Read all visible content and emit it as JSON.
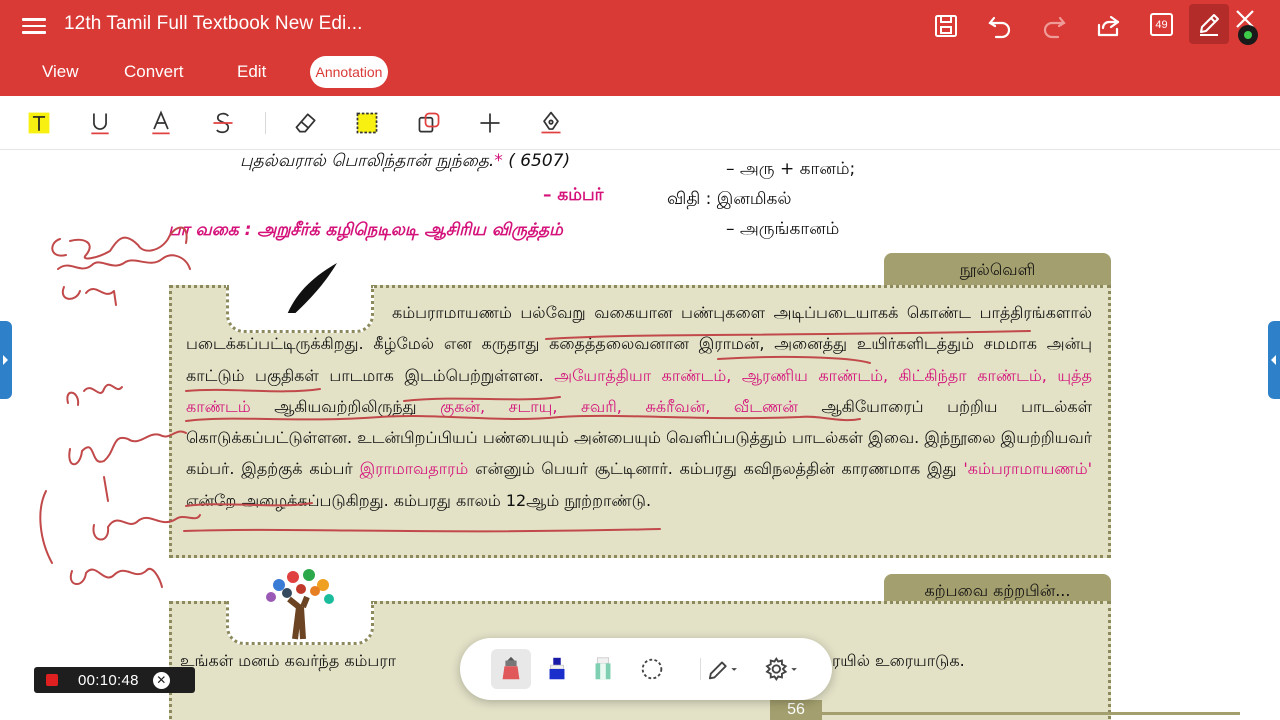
{
  "app": {
    "title": "12th Tamil Full Textbook New Edi...",
    "page_count_badge": "49",
    "colors": {
      "primary": "#d93a36",
      "accent_magenta": "#d4127a",
      "olive": "#a39f6e",
      "box_bg": "#e3e2c7"
    }
  },
  "toolbar_icons": [
    "save-icon",
    "undo-icon",
    "redo-icon",
    "share-icon",
    "page-count-icon",
    "pen-edit-icon",
    "close-icon"
  ],
  "tabs": [
    {
      "label": "View"
    },
    {
      "label": "Convert"
    },
    {
      "label": "Edit"
    },
    {
      "label": "Annotation",
      "active": true
    }
  ],
  "annotation_tools": [
    "text-highlight-icon",
    "underline-icon",
    "text-color-icon",
    "strikethrough-icon",
    "eraser-icon",
    "area-highlight-icon",
    "shape-icon",
    "add-icon",
    "pen-sign-icon"
  ],
  "page": {
    "poem": {
      "line": "புதல்வரால் பொலிந்தான் நுந்தை.",
      "asterisk": "*",
      "verse_no": "( 6507)",
      "author": "– கம்பர்",
      "meter": "பா வகை : அறுசீர்க் கழிநெடிலடி ஆசிரிய விருத்தம்"
    },
    "grammar": {
      "line1": "– அரு + கானம்;",
      "rule": "விதி : இனமிகல்",
      "line3": "– அருங்கானம்"
    },
    "nool_veli": {
      "tab_label": "நூல்வெளி",
      "p1": "கம்பராமாயணம் பல்வேறு வகையான பண்புகளை அடிப்படையாகக் கொண்ட பாத்திரங்களால் படைக்கப்பட்டிருக்கிறது. கீழ்மேல் என கருதாது கதைத்தலைவனான இராமன், அனைத்து உயிர்களிடத்தும் சமமாக அன்பு காட்டும் பகுதிகள் பாடமாக இடம்பெற்றுள்ளன.",
      "kandam_list": "அயோத்தியா காண்டம், ஆரணிய காண்டம், கிட்கிந்தா காண்டம், யுத்த காண்டம்",
      "p2": "ஆகியவற்றிலிருந்து",
      "names": "குகன், சடாயு, சவரி, சுக்ரீவன், வீடணன்",
      "p3": "ஆகியோரைப் பற்றிய பாடல்கள் கொடுக்கப்பட்டுள்ளன. உடன்பிறப்பியப் பண்பையும் அன்பையும் வெளிப்படுத்தும் பாடல்கள் இவை. இந்நூலை இயற்றியவர் கம்பர். இதற்குக் கம்பர்",
      "ramavatharam": "இராமாவதாரம்",
      "p4": "என்னும் பெயர் சூட்டினார். கம்பரது கவிநலத்தின் காரணமாக இது",
      "kambaramayanam": "'கம்பராமாயணம்'",
      "p5": "என்றே அழைக்கப்படுகிறது. கம்பரது காலம் 12ஆம் நூற்றாண்டு."
    },
    "karpavai": {
      "tab_label": "கற்பவை கற்றபின்...",
      "text_left": "உங்கள்  மனம் கவர்ந்த கம்பரா",
      "text_right": "ரயில் உரையாடுக."
    },
    "page_number": "56"
  },
  "recorder": {
    "time": "00:10:48"
  },
  "float_tools": [
    "marker-pen-icon",
    "highlighter-blue-icon",
    "highlighter-green-icon",
    "lasso-icon",
    "pen-options-icon",
    "settings-icon"
  ]
}
